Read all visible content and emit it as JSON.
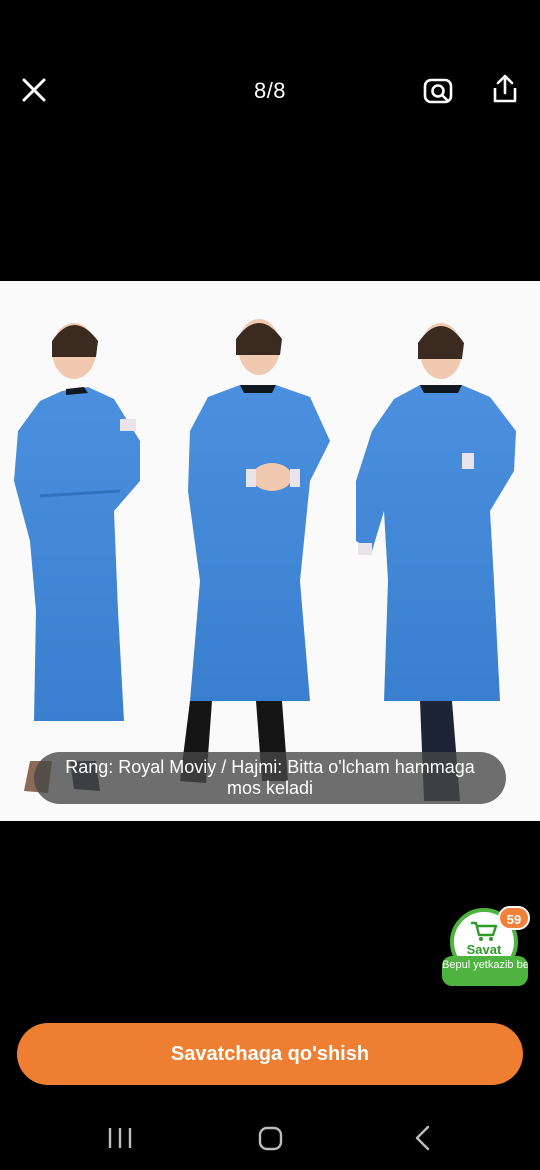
{
  "header": {
    "counter": "8/8"
  },
  "image": {
    "caption": "Rang: Royal Moviy / Hajmi: Bitta o'lcham hammaga mos keladi",
    "product_color": "#3f86d4"
  },
  "cart": {
    "label": "Savat",
    "badge": "59",
    "ribbon": "Bepul yetkazib beri..."
  },
  "actions": {
    "add_to_cart": "Savatchaga qo'shish"
  },
  "colors": {
    "accent": "#ee7f32",
    "cart_green": "#4fb33f"
  },
  "icons": [
    "close-icon",
    "camera-search-icon",
    "share-icon",
    "cart-icon",
    "recent-apps-icon",
    "home-icon",
    "back-icon"
  ]
}
